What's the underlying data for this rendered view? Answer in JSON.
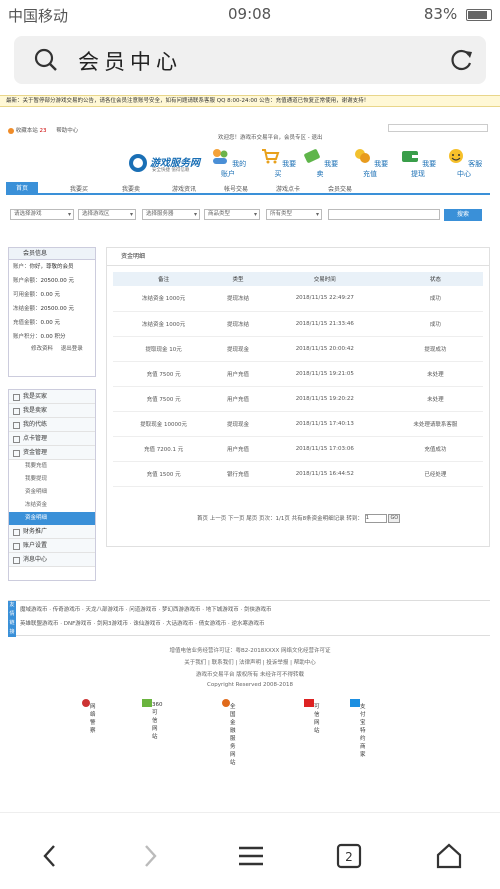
{
  "status_bar": {
    "carrier": "中国移动",
    "time": "09:08",
    "battery": "83%"
  },
  "browser": {
    "title": "会员中心"
  },
  "ticker": "最新：关于暂停部分游戏交易的公告，请各位会员注意账号安全，如有问题请联系客服 QQ 8:00-24:00 公告：充值通道已恢复正常使用，谢谢支持！",
  "top_links": {
    "favorite": "收藏本站",
    "fav_count": "23",
    "help": "帮助中心"
  },
  "welcome": "欢迎您！游戏币交易平台，会员专区 - 退出",
  "logo": {
    "name": "游戏服务网",
    "slogan": "安全快捷 值得信赖"
  },
  "nav_icons": [
    "我的账户",
    "我要买",
    "我要卖",
    "我要充值",
    "我要提现",
    "客服中心"
  ],
  "menu": [
    "首页",
    "我要买",
    "我要卖",
    "游戏资讯",
    "帐号交易",
    "游戏点卡",
    "会员交易"
  ],
  "filters": [
    "请选择游戏",
    "选择游戏区",
    "选择服务器",
    "商品类型",
    "所有类型"
  ],
  "search_button": "搜索",
  "member_panel": {
    "header": "会员信息",
    "rows": [
      {
        "label": "账户：",
        "value": "你好，尊敬的会员"
      },
      {
        "label": "账户余额：",
        "value": "20500.00 元"
      },
      {
        "label": "可用金额：",
        "value": "0.00 元"
      },
      {
        "label": "冻结金额：",
        "value": "20500.00 元"
      },
      {
        "label": "充值金额：",
        "value": "0.00 元"
      },
      {
        "label": "账户积分：",
        "value": "0.00 积分"
      }
    ],
    "links": [
      "修改资料",
      "退出登录"
    ]
  },
  "side_menu": [
    {
      "label": "我是买家",
      "subs": []
    },
    {
      "label": "我是卖家",
      "subs": []
    },
    {
      "label": "我的代练",
      "subs": []
    },
    {
      "label": "点卡管理",
      "subs": []
    },
    {
      "label": "资金管理",
      "subs": [
        "我要充值",
        "我要提现",
        "资金明细",
        "冻结资金",
        "资金明细"
      ]
    },
    {
      "label": "财务推广",
      "subs": []
    },
    {
      "label": "账户设置",
      "subs": []
    },
    {
      "label": "消息中心",
      "subs": []
    }
  ],
  "main": {
    "header": "资金明细",
    "columns": [
      "备注",
      "类型",
      "交易时间",
      "状态"
    ],
    "rows": [
      [
        "冻结资金 1000元",
        "提现冻结",
        "2018/11/15 22:49:27",
        "成功"
      ],
      [
        "冻结资金 1000元",
        "提现冻结",
        "2018/11/15 21:33:46",
        "成功"
      ],
      [
        "提取现金 10元",
        "提现现金",
        "2018/11/15 20:00:42",
        "提现成功"
      ],
      [
        "充值 7500 元",
        "用户充值",
        "2018/11/15 19:21:05",
        "未处理"
      ],
      [
        "充值 7500 元",
        "用户充值",
        "2018/11/15 19:20:22",
        "未处理"
      ],
      [
        "提取现金 10000元",
        "提现现金",
        "2018/11/15 17:40:13",
        "未处理请联系客服"
      ],
      [
        "充值 7200.1 元",
        "用户充值",
        "2018/11/15 17:03:06",
        "充值成功"
      ],
      [
        "充值 1500 元",
        "银行充值",
        "2018/11/15 16:44:52",
        "已经处理"
      ]
    ],
    "pager": "首页 上一页 下一页 尾页 页次：1/1页 共有8条资金明细记录 转到：",
    "page_value": "1",
    "go": "GO"
  },
  "footer_tag": "友情链接",
  "footer_links": [
    "魔域游戏币 · 传奇游戏币 · 天龙八部游戏币 · 问道游戏币 · 梦幻西游游戏币 · 地下城游戏币 · 剑侠游戏币",
    "英雄联盟游戏币 · DNF游戏币 · 剑网3游戏币 · 诛仙游戏币 · 大话游戏币 · 倩女游戏币 · 逆水寒游戏币"
  ],
  "copyright": [
    "增值电信业务经营许可证：粤B2-2018XXXX  网络文化经营许可证",
    "关于我们 | 联系我们 | 法律声明 | 投诉举报 | 帮助中心",
    "游戏币交易平台 版权所有  未经许可不得转载",
    "Copyright Reserved 2008-2018"
  ],
  "badges": [
    "网络警察",
    "360可信网站",
    "全国金融服务网站",
    "可信网站",
    "支付宝特约商家"
  ]
}
